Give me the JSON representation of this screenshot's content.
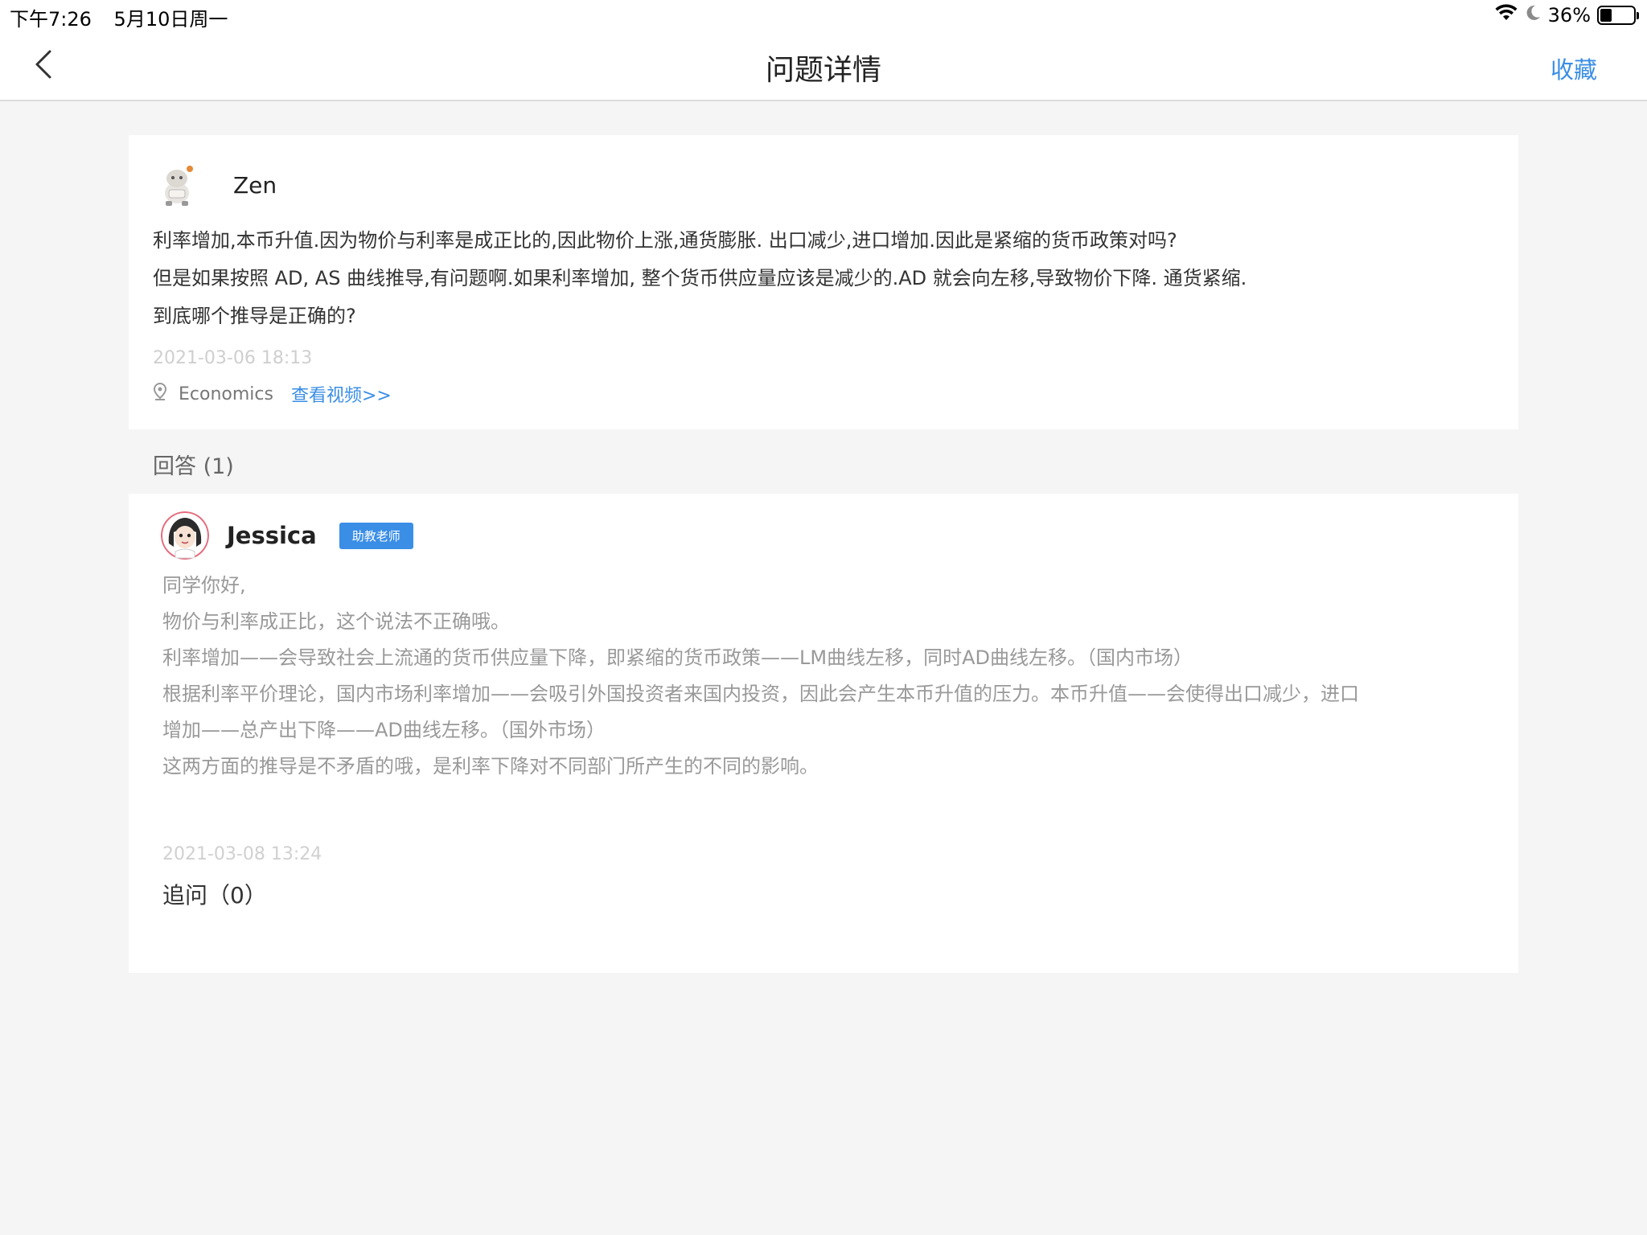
{
  "status_bar": {
    "time": "下午7:26",
    "date": "5月10日周一",
    "battery": "36%",
    "battery_level": 0.36,
    "icons": [
      "wifi-icon",
      "moon-icon",
      "battery-icon"
    ]
  },
  "nav": {
    "title": "问题详情",
    "back_icon": "chevron-left-icon",
    "favorite_label": "收藏",
    "accent_color": "#3a8ee6"
  },
  "question": {
    "author": "Zen",
    "avatar_icon": "robot-avatar",
    "lines": [
      "利率增加,本币升值.因为物价与利率是成正比的,因此物价上涨,通货膨胀. 出口减少,进口增加.因此是紧缩的货币政策对吗?",
      "但是如果按照 AD, AS 曲线推导,有问题啊.如果利率增加, 整个货币供应量应该是减少的.AD 就会向左移,导致物价下降. 通货紧缩.",
      "到底哪个推导是正确的?"
    ],
    "time": "2021-03-06 18:13",
    "location_icon": "location-pin-icon",
    "subject": "Economics",
    "video_link": "查看视频>>"
  },
  "answers": {
    "title": "回答 (1)",
    "items": [
      {
        "author": "Jessica",
        "badge": "助教老师",
        "avatar_icon": "girl-avatar",
        "lines": [
          "同学你好,",
          "物价与利率成正比，这个说法不正确哦。",
          "利率增加——会导致社会上流通的货币供应量下降，即紧缩的货币政策——LM曲线左移，同时AD曲线左移。（国内市场）",
          "根据利率平价理论，国内市场利率增加——会吸引外国投资者来国内投资，因此会产生本币升值的压力。本币升值——会使得出口减少，进口",
          "增加——总产出下降——AD曲线左移。（国外市场）",
          "这两方面的推导是不矛盾的哦，是利率下降对不同部门所产生的不同的影响。"
        ],
        "time": "2021-03-08 13:24",
        "followup": "追问（0）"
      }
    ]
  }
}
